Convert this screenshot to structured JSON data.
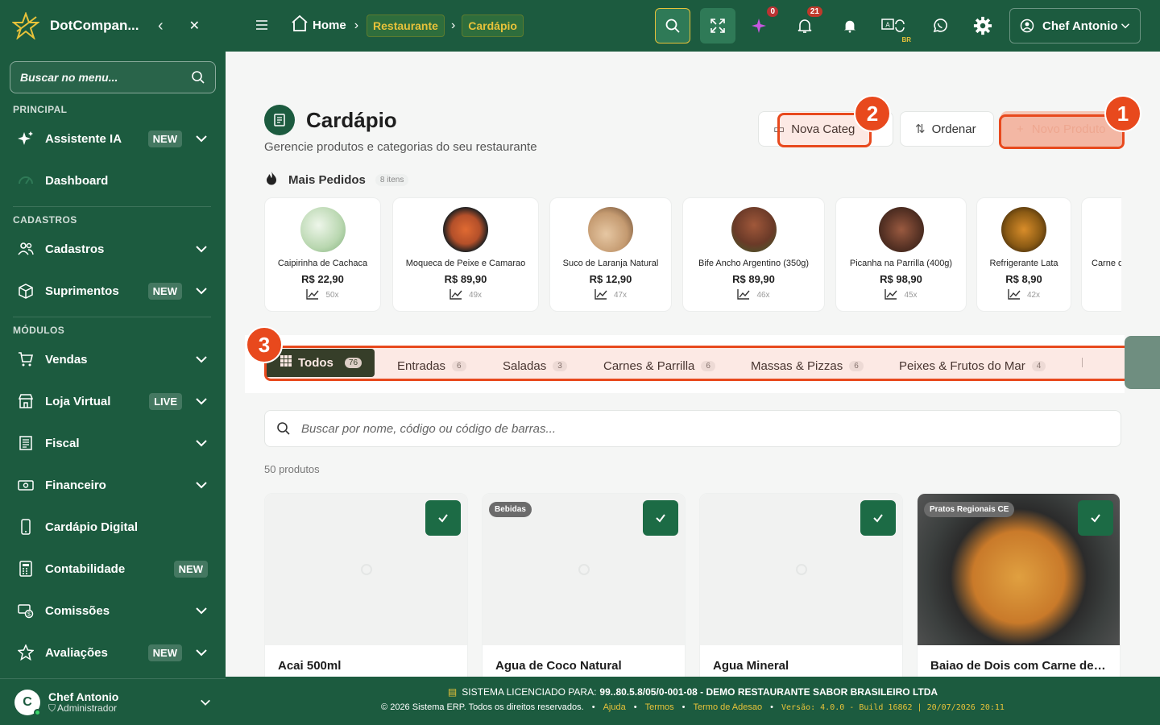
{
  "sidebar": {
    "brand": "DotCompan...",
    "search_placeholder": "Buscar no menu...",
    "sections": {
      "principal": "PRINCIPAL",
      "cadastros": "CADASTROS",
      "modulos": "MÓDULOS"
    },
    "items": [
      {
        "label": "Assistente IA",
        "badge": "NEW",
        "icon": "sparkle-icon"
      },
      {
        "label": "Dashboard",
        "icon": "gauge-icon"
      },
      {
        "label": "Cadastros",
        "icon": "users-icon"
      },
      {
        "label": "Suprimentos",
        "badge": "NEW",
        "icon": "box-icon"
      },
      {
        "label": "Vendas",
        "icon": "cart-icon"
      },
      {
        "label": "Loja Virtual",
        "badge": "LIVE",
        "icon": "store-icon"
      },
      {
        "label": "Fiscal",
        "icon": "receipt-icon"
      },
      {
        "label": "Financeiro",
        "icon": "money-icon"
      },
      {
        "label": "Cardápio Digital",
        "icon": "phone-icon"
      },
      {
        "label": "Contabilidade",
        "badge": "NEW",
        "icon": "calculator-icon"
      },
      {
        "label": "Comissões",
        "icon": "commission-icon"
      },
      {
        "label": "Avaliações",
        "badge": "NEW",
        "icon": "star-icon"
      }
    ],
    "user": {
      "initial": "C",
      "name": "Chef Antonio",
      "role": "Administrador"
    }
  },
  "topbar": {
    "breadcrumb": {
      "home": "Home",
      "restaurante": "Restaurante",
      "cardapio": "Cardápio"
    },
    "ai_badge": "0",
    "notif_badge": "21",
    "lang_label": "BR",
    "user_name": "Chef Antonio"
  },
  "page": {
    "title": "Cardápio",
    "subtitle": "Gerencie produtos e categorias do seu restaurante",
    "buttons": {
      "nova_categoria": "Nova Categ",
      "ordenar": "Ordenar",
      "novo_produto": "Novo Produto"
    },
    "markers": [
      "1",
      "2",
      "3"
    ]
  },
  "mais_pedidos": {
    "title": "Mais Pedidos",
    "count": "8 itens",
    "items": [
      {
        "name": "Caipirinha de Cachaca",
        "price": "R$ 22,90",
        "count": "50x",
        "color": "#b9d7b0"
      },
      {
        "name": "Moqueca de Peixe e Camarao",
        "price": "R$ 89,90",
        "count": "49x",
        "color": "#b4502a"
      },
      {
        "name": "Suco de Laranja Natural",
        "price": "R$ 12,90",
        "count": "47x",
        "color": "#c49a70"
      },
      {
        "name": "Bife Ancho Argentino (350g)",
        "price": "R$ 89,90",
        "count": "46x",
        "color": "#6b3a28"
      },
      {
        "name": "Picanha na Parrilla (400g)",
        "price": "R$ 98,90",
        "count": "45x",
        "color": "#5a3426"
      },
      {
        "name": "Refrigerante Lata",
        "price": "R$ 8,90",
        "count": "42x",
        "color": "#8a5a14"
      },
      {
        "name": "Carne d",
        "price": "",
        "count": "",
        "color": "#ffffff"
      }
    ]
  },
  "categories": [
    {
      "label": "Todos",
      "count": "76"
    },
    {
      "label": "Entradas",
      "count": "6"
    },
    {
      "label": "Saladas",
      "count": "3"
    },
    {
      "label": "Carnes & Parrilla",
      "count": "6"
    },
    {
      "label": "Massas & Pizzas",
      "count": "6"
    },
    {
      "label": "Peixes & Frutos do Mar",
      "count": "4"
    }
  ],
  "search": {
    "placeholder": "Buscar por nome, código ou código de barras..."
  },
  "products": {
    "count_label": "50 produtos",
    "items": [
      {
        "name": "Acai 500ml",
        "tag": ""
      },
      {
        "name": "Agua de Coco Natural",
        "tag": "Bebidas"
      },
      {
        "name": "Agua Mineral",
        "tag": ""
      },
      {
        "name": "Baiao de Dois com Carne de ...",
        "tag": "Pratos Regionais CE"
      }
    ]
  },
  "footer": {
    "license_prefix": "SISTEMA LICENCIADO PARA:",
    "license_value": "99..80.5.8/05/0-001-08 - DEMO RESTAURANTE SABOR BRASILEIRO LTDA",
    "copyright": "© 2026 Sistema ERP. Todos os direitos reservados.",
    "links": [
      "Ajuda",
      "Termos",
      "Termo de Adesao"
    ],
    "version": "Versão: 4.0.0 - Build 16862 | 20/07/2026 20:11"
  },
  "colors": {
    "primary": "#1c5b3f",
    "accent": "#e7c23a",
    "marker": "#e8491d"
  }
}
